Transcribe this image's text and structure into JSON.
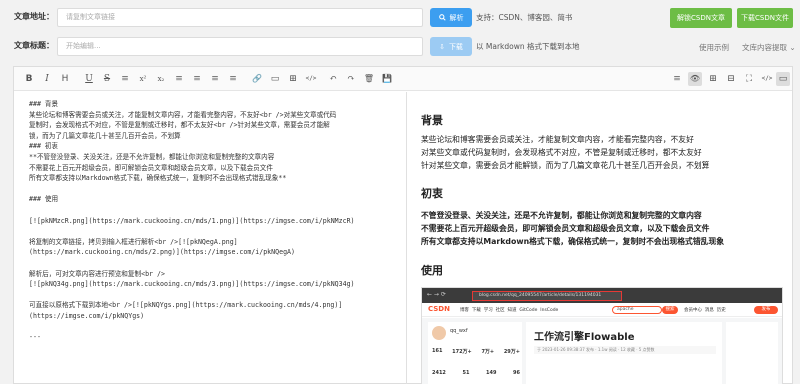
{
  "form": {
    "url_label": "文章地址：",
    "url_placeholder": "请复制文章链接",
    "parse_button": "解析",
    "support_text": "支持：CSDN、博客园、简书",
    "title_label": "文章标题：",
    "title_placeholder": "开始编辑...",
    "download_button": "下载",
    "download_hint": "以 Markdown 格式下载到本地",
    "unlock_button": "解锁CSDN文章",
    "download_csdn_button": "下载CSDN文件",
    "usage_link": "使用示例",
    "copy_content_link": "文库内容提取",
    "copy_content_chevron": "⌄"
  },
  "toolbar": {
    "left_tools": [
      "B",
      "I",
      "H",
      "U",
      "S",
      "≡",
      "x²",
      "x₂",
      "≡",
      "≡",
      "≡",
      "≡",
      "🔗",
      "▭",
      "⊞",
      "</>",
      "↶",
      "↷",
      "🗑",
      "💾"
    ],
    "right_tools": [
      "≡",
      "👁",
      "⊞",
      "⊟",
      "⛶",
      "</>",
      "▭"
    ]
  },
  "markdown_lines": [
    "### 背景",
    "某些论坛和博客需要会员或关注，才能复制文章内容，才能看完整内容，不友好<br />对某些文章或代码",
    "复制时，会发现格式不对应，不管是复制或迁移时，都不太友好<br />针对某些文章，需要会员才能解",
    "锁，而为了几篇文章花几十甚至几百开会员，不划算",
    "### 初衷",
    "**不管登没登录、关没关注，还是不允许复制，都能让你浏览和复制完整的文章内容",
    "不需要花上百元开超级会员，即可解锁会员文章和超级会员文章，以及下载会员文件",
    "所有文章都支持以Markdown格式下载，确保格式统一，复制时不会出现格式错乱现象**",
    "",
    "### 使用",
    "",
    "[![pkNMzcR.png](https://mark.cuckooing.cn/mds/1.png)](https://imgse.com/i/pkNMzcR)",
    "",
    "将复制的文章链接，拷贝到输入框进行解析<br />[![pkNQegA.png]",
    "(https://mark.cuckooing.cn/mds/2.png)](https://imgse.com/i/pkNQegA)",
    "",
    "解析后，可对文章内容进行预览和复制<br />",
    "[![pkNQ34g.png](https://mark.cuckooing.cn/mds/3.png)](https://imgse.com/i/pkNQ34g)",
    "",
    "可直接以原格式下载到本地<br />[![pkNQYgs.png](https://mark.cuckooing.cn/mds/4.png)]",
    "(https://imgse.com/i/pkNQYgs)",
    "",
    "---"
  ],
  "preview": {
    "h_background": "背景",
    "p_background_1": "某些论坛和博客需要会员或关注，才能复制文章内容，才能看完整内容，不友好",
    "p_background_2": "对某些文章或代码复制时，会发现格式不对应，不管是复制或迁移时，都不太友好",
    "p_background_3": "针对某些文章，需要会员才能解锁，而为了几篇文章花几十甚至几百开会员，不划算",
    "h_intent": "初衷",
    "p_intent_1": "不管登没登录、关没关注，还是不允许复制，都能让你浏览和复制完整的文章内容",
    "p_intent_2": "不需要花上百元开超级会员，即可解锁会员文章和超级会员文章，以及下载会员文件",
    "p_intent_3": "所有文章都支持以Markdown格式下载，确保格式统一，复制时不会出现格式错乱现象",
    "h_usage": "使用",
    "screenshot": {
      "address": "blog.csdn.net/qq_24095547/article/details/131194031",
      "site_logo": "CSDN",
      "nav": [
        "博客",
        "下载",
        "学习",
        "社区",
        "知道",
        "GitCode",
        "InsCode"
      ],
      "search_value": "apache",
      "search_button": "搜索",
      "user": "qq_wxf",
      "stats_top": [
        "161",
        "172万+",
        "7万+",
        "29万+"
      ],
      "stats_bottom": [
        "2412",
        "51",
        "149",
        "96"
      ],
      "article_title": "工作流引擎Flowable",
      "article_meta": "于 2023-01-26 09:38:37 发布 · 1.1w 阅读 · 12 收藏 · 5 点赞数",
      "member_center": "会员中心",
      "message": "消息",
      "history": "历史",
      "publish": "发布"
    }
  },
  "colors": {
    "blue": "#3c9ef0",
    "blue_light": "#9ccbf3",
    "green": "#6dbd45",
    "red_box": "#e53935",
    "csdn_red": "#fc5531"
  }
}
